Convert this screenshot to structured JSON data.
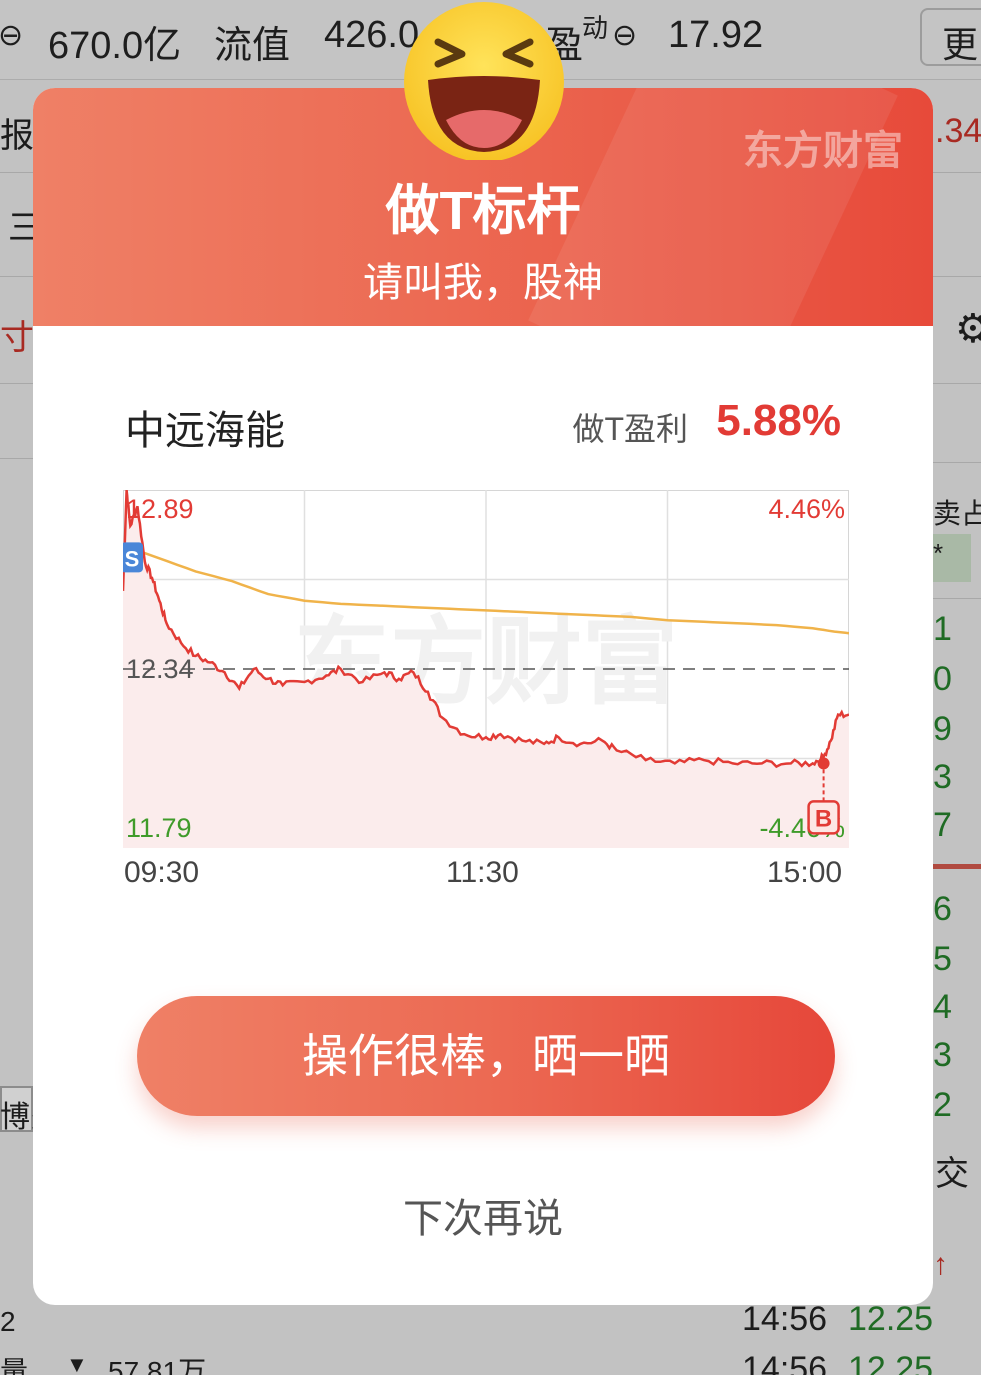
{
  "background": {
    "market_cap": "670.0亿",
    "float_label": "流值",
    "float_value": "426.0",
    "pe_label": "盈",
    "pe_sup": "动",
    "pe_value": "17.92",
    "more_button": "更",
    "report_label": "报",
    "report_value": ".34",
    "three_label": "三",
    "tab_label": "寸",
    "ratio_label": "卖占",
    "star": "*",
    "right_digits": [
      "1",
      "0",
      "9",
      "3",
      "7",
      "6",
      "5",
      "4",
      "3",
      "2"
    ],
    "game_label": "博多",
    "trade_label": "交",
    "arrow": "↑",
    "axis_digit": "2",
    "trades": [
      {
        "time": "14:56",
        "price": "12.25"
      },
      {
        "time": "14:56",
        "price": "12.25"
      }
    ],
    "volume_label": "量",
    "volume_value": "57.81万"
  },
  "modal": {
    "brand": "东方财富",
    "title": "做T标杆",
    "subtitle": "请叫我，股神",
    "stock_name": "中远海能",
    "profit_label": "做T盈利",
    "profit_value": "5.88%",
    "share_button": "操作很棒，晒一晒",
    "later_button": "下次再说",
    "colors": {
      "accent": "#e74a3a",
      "price_line": "#e23b35",
      "avg_line": "#f0b34a",
      "up": "#e23b35",
      "down": "#3f9b2a"
    }
  },
  "chart_data": {
    "type": "line",
    "watermark": "东方财富",
    "x_ticks": [
      "09:30",
      "11:30",
      "15:00"
    ],
    "y_max_label": "12.89",
    "y_mid_label": "12.34",
    "y_min_label": "11.79",
    "pct_max_label": "4.46%",
    "pct_min_label": "-4.46%",
    "ylim": [
      11.79,
      12.89
    ],
    "prev_close": 12.34,
    "sell_marker": {
      "label": "S",
      "time_index": 0,
      "price": 12.68
    },
    "buy_marker": {
      "label": "B",
      "time_index": 0.965,
      "price": 12.05
    },
    "series": [
      {
        "name": "price",
        "x": [
          0,
          0.005,
          0.01,
          0.02,
          0.03,
          0.04,
          0.05,
          0.06,
          0.08,
          0.1,
          0.12,
          0.14,
          0.16,
          0.18,
          0.2,
          0.22,
          0.25,
          0.28,
          0.3,
          0.33,
          0.36,
          0.38,
          0.4,
          0.42,
          0.44,
          0.47,
          0.5,
          0.52,
          0.55,
          0.58,
          0.6,
          0.63,
          0.66,
          0.68,
          0.72,
          0.76,
          0.8,
          0.84,
          0.88,
          0.92,
          0.95,
          0.965,
          0.975,
          0.985,
          1.0
        ],
        "values": [
          12.58,
          12.89,
          12.78,
          12.84,
          12.67,
          12.62,
          12.55,
          12.48,
          12.42,
          12.38,
          12.36,
          12.33,
          12.28,
          12.34,
          12.31,
          12.29,
          12.3,
          12.32,
          12.34,
          12.3,
          12.33,
          12.31,
          12.33,
          12.27,
          12.19,
          12.14,
          12.13,
          12.14,
          12.12,
          12.11,
          12.13,
          12.11,
          12.12,
          12.09,
          12.06,
          12.05,
          12.06,
          12.05,
          12.05,
          12.05,
          12.05,
          12.07,
          12.12,
          12.2,
          12.2
        ]
      },
      {
        "name": "average",
        "x": [
          0,
          0.05,
          0.1,
          0.15,
          0.2,
          0.25,
          0.3,
          0.35,
          0.4,
          0.45,
          0.5,
          0.55,
          0.6,
          0.65,
          0.7,
          0.75,
          0.8,
          0.85,
          0.9,
          0.95,
          0.98,
          1.0
        ],
        "values": [
          12.72,
          12.68,
          12.64,
          12.61,
          12.57,
          12.55,
          12.54,
          12.535,
          12.53,
          12.525,
          12.52,
          12.515,
          12.51,
          12.505,
          12.5,
          12.49,
          12.485,
          12.48,
          12.475,
          12.465,
          12.455,
          12.45
        ]
      }
    ]
  }
}
